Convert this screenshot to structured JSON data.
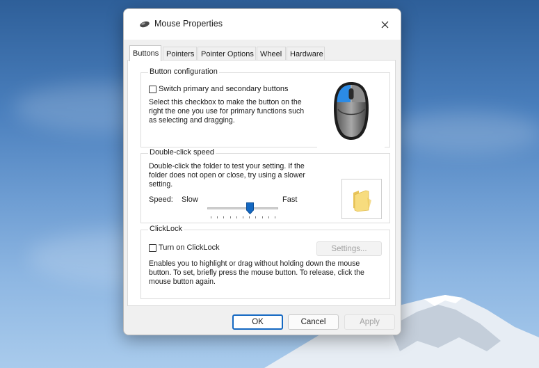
{
  "window": {
    "title": "Mouse Properties"
  },
  "tabs": [
    "Buttons",
    "Pointers",
    "Pointer Options",
    "Wheel",
    "Hardware"
  ],
  "button_configuration": {
    "legend": "Button configuration",
    "checkbox_label": "Switch primary and secondary buttons",
    "checked": false,
    "description_lines": [
      "Select this checkbox to make the button on the",
      "right the one you use for primary functions such",
      "as selecting and dragging."
    ]
  },
  "double_click_speed": {
    "legend": "Double-click speed",
    "description_lines": [
      "Double-click the folder to test your setting. If the",
      "folder does not open or close, try using a slower",
      "setting."
    ],
    "speed_label": "Speed:",
    "slow_label": "Slow",
    "fast_label": "Fast",
    "slider_value_fraction": 0.6
  },
  "clicklock": {
    "legend": "ClickLock",
    "checkbox_label": "Turn on ClickLock",
    "checked": false,
    "settings_button": "Settings...",
    "description_lines": [
      "Enables you to highlight or drag without holding down the mouse",
      "button. To set, briefly press the mouse button. To release, click the",
      "mouse button again."
    ]
  },
  "footer": {
    "ok": "OK",
    "cancel": "Cancel",
    "apply": "Apply"
  },
  "colors": {
    "accent": "#1468c2",
    "mouse_highlight": "#2b8be6"
  }
}
